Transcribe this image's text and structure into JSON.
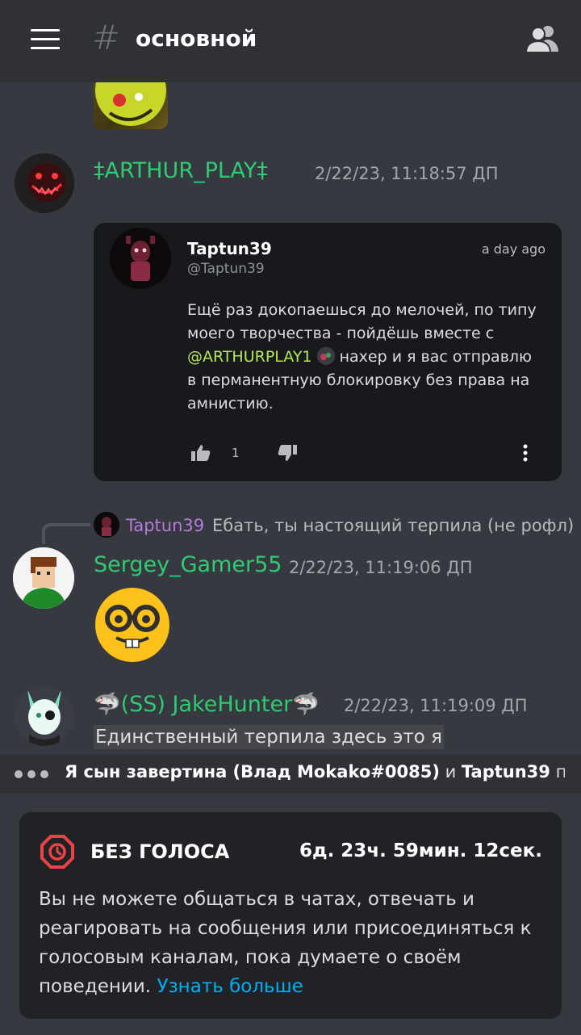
{
  "header": {
    "channel_name": "основной"
  },
  "messages": [
    {
      "username": "‡ARTHUR_PLAY‡",
      "timestamp": "2/22/23, 11:18:57 ДП",
      "username_color": "#2ecc71",
      "embed": {
        "author": "Taptun39",
        "handle": "@Taptun39",
        "time": "a day ago",
        "text_before": "Ещё раз докопаешься до мелочей, по типу моего творчества - пойдёшь вместе с ",
        "mention": "@ARTHURPLAY1",
        "text_after": " нахер и я вас отправлю в перманентную блокировку без права на амнистию.",
        "like_count": "1"
      }
    },
    {
      "reply": {
        "username": "Taptun39",
        "text": "Ебать, ты настоящий терпила (не рофл)"
      },
      "username": "Sergey_Gamer55",
      "timestamp": "2/22/23, 11:19:06 ДП",
      "username_color": "#2ecc71"
    },
    {
      "username": "🦈(SS) JakeHunter🦈",
      "timestamp": "2/22/23, 11:19:09 ДП",
      "text": "Единственный терпила здесь это я",
      "username_color": "#2ecc71"
    }
  ],
  "typing": {
    "user1": "Я сын завертина (Влад Mokako#0085)",
    "conj": " и ",
    "user2": "Taptun39",
    "suffix": " печат..."
  },
  "timeout": {
    "title": "БЕЗ ГОЛОСА",
    "timer": "6д. 23ч. 59мин. 12сек.",
    "body": "Вы не можете общаться в чатах, отвечать и реагировать на сообщения или присоединяться к голосовым каналам, пока думаете о своём поведении.",
    "link": "Узнать больше"
  }
}
